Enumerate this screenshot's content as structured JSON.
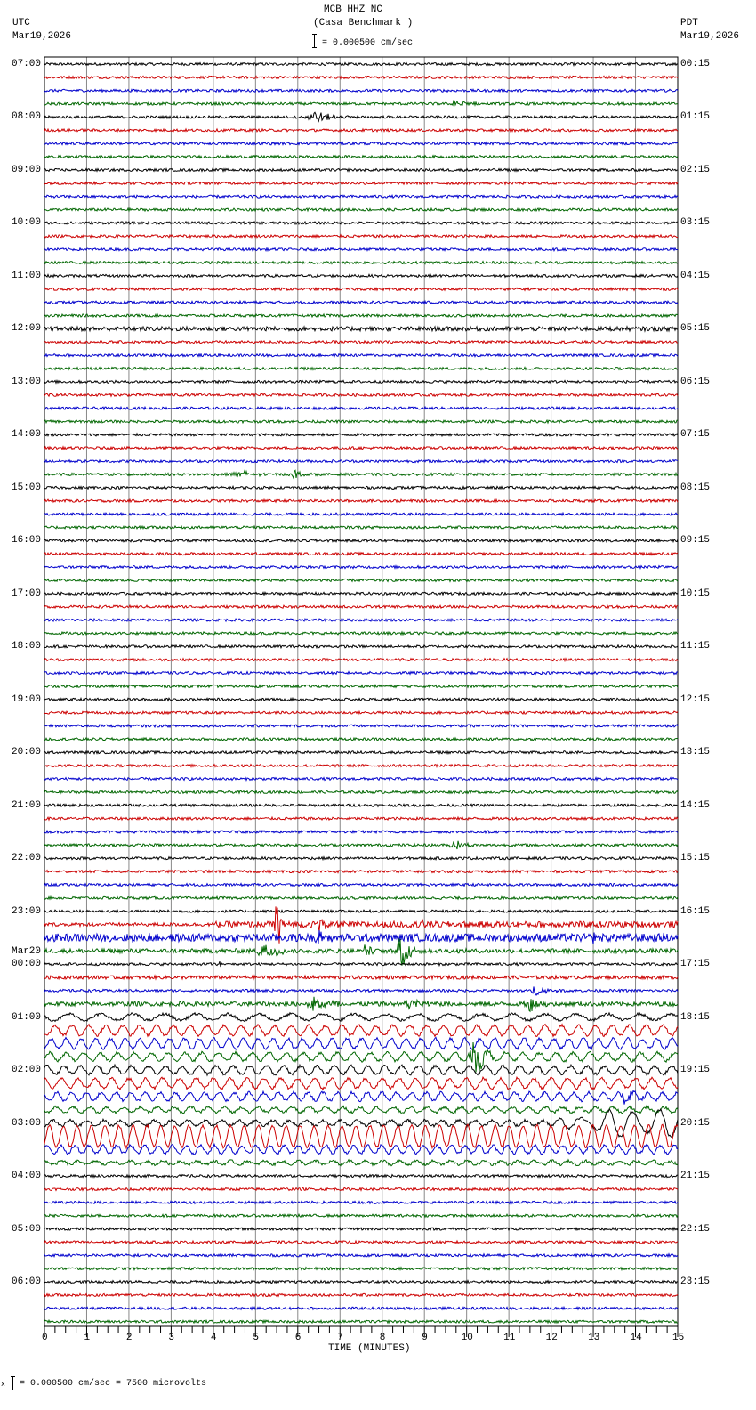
{
  "header": {
    "station": "MCB HHZ NC",
    "site": "(Casa Benchmark )",
    "scale": "= 0.000500 cm/sec",
    "left_tz": "UTC",
    "left_date": "Mar19,2026",
    "right_tz": "PDT",
    "right_date": "Mar19,2026"
  },
  "footer": {
    "scale_prefix": "x",
    "scale": "= 0.000500 cm/sec =    7500 microvolts"
  },
  "chart_data": {
    "type": "line",
    "title": "MCB HHZ NC (Casa Benchmark )",
    "xlabel": "TIME (MINUTES)",
    "xlim": [
      0,
      15
    ],
    "x_ticks": [
      "0",
      "1",
      "2",
      "3",
      "4",
      "5",
      "6",
      "7",
      "8",
      "9",
      "10",
      "11",
      "12",
      "13",
      "14",
      "15"
    ],
    "left_labels": [
      "07:00",
      "08:00",
      "09:00",
      "10:00",
      "11:00",
      "12:00",
      "13:00",
      "14:00",
      "15:00",
      "16:00",
      "17:00",
      "18:00",
      "19:00",
      "20:00",
      "21:00",
      "22:00",
      "23:00",
      "00:00",
      "01:00",
      "02:00",
      "03:00",
      "04:00",
      "05:00",
      "06:00"
    ],
    "date_change_label": "Mar20",
    "right_labels": [
      "00:15",
      "01:15",
      "02:15",
      "03:15",
      "04:15",
      "05:15",
      "06:15",
      "07:15",
      "08:15",
      "09:15",
      "10:15",
      "11:15",
      "12:15",
      "13:15",
      "14:15",
      "15:15",
      "16:15",
      "17:15",
      "18:15",
      "19:15",
      "20:15",
      "21:15",
      "22:15",
      "23:15"
    ],
    "trace_colors": [
      "#000000",
      "#cc0000",
      "#0000cc",
      "#006600"
    ],
    "traces_per_hour": 4,
    "trace_count": 96,
    "default_noise": 0.15,
    "special_traces": [
      {
        "i": 3,
        "events": [
          {
            "t": 9.7,
            "d": 0.6,
            "a": 0.6
          }
        ]
      },
      {
        "i": 4,
        "events": [
          {
            "t": 6.4,
            "d": 0.8,
            "a": 0.7
          }
        ]
      },
      {
        "i": 20,
        "noise": 0.25
      },
      {
        "i": 31,
        "events": [
          {
            "t": 4.6,
            "d": 0.8,
            "a": 0.5
          },
          {
            "t": 5.9,
            "d": 0.4,
            "a": 0.6
          }
        ]
      },
      {
        "i": 59,
        "events": [
          {
            "t": 9.7,
            "d": 0.5,
            "a": 0.6
          }
        ]
      },
      {
        "i": 65,
        "noise": 0.2,
        "noise2": 0.35,
        "noise2_from": 4,
        "events": [
          {
            "t": 5.5,
            "d": 0.25,
            "a": 3.5
          },
          {
            "t": 6.5,
            "d": 0.3,
            "a": 1.2
          },
          {
            "t": 8.9,
            "d": 0.2,
            "a": 0.8
          }
        ]
      },
      {
        "i": 66,
        "noise": 0.45,
        "events": [
          {
            "t": 6.5,
            "d": 0.3,
            "a": 1
          },
          {
            "t": 13,
            "d": 0.1,
            "a": 1.2
          }
        ]
      },
      {
        "i": 67,
        "noise": 0.25,
        "events": [
          {
            "t": 5.2,
            "d": 0.6,
            "a": 1.2
          },
          {
            "t": 7.6,
            "d": 0.2,
            "a": 1
          },
          {
            "t": 8.45,
            "d": 0.4,
            "a": 3
          }
        ]
      },
      {
        "i": 68,
        "events": [
          {
            "t": 4.1,
            "d": 0.3,
            "a": 0.7
          }
        ]
      },
      {
        "i": 69,
        "noise": 0.2
      },
      {
        "i": 70,
        "events": [
          {
            "t": 11.6,
            "d": 0.6,
            "a": 0.6
          }
        ]
      },
      {
        "i": 71,
        "noise": 0.25,
        "events": [
          {
            "t": 6.4,
            "d": 1,
            "a": 0.8
          },
          {
            "t": 8.6,
            "d": 0.6,
            "a": 0.9
          },
          {
            "t": 11.5,
            "d": 0.5,
            "a": 1
          }
        ]
      },
      {
        "i": 72,
        "wave": {
          "a": 0.35,
          "p": 0.75
        }
      },
      {
        "i": 73,
        "wave": {
          "a": 0.55,
          "p": 0.4
        }
      },
      {
        "i": 74,
        "wave": {
          "a": 0.55,
          "p": 0.35
        }
      },
      {
        "i": 75,
        "wave": {
          "a": 0.45,
          "p": 0.4
        },
        "events": [
          {
            "t": 10.2,
            "d": 0.6,
            "a": 1.8
          }
        ]
      },
      {
        "i": 76,
        "wave": {
          "a": 0.45,
          "p": 0.4
        }
      },
      {
        "i": 77,
        "wave": {
          "a": 0.55,
          "p": 0.4
        }
      },
      {
        "i": 78,
        "wave": {
          "a": 0.45,
          "p": 0.35
        },
        "events": [
          {
            "t": 13.8,
            "d": 0.8,
            "a": 0.6
          }
        ]
      },
      {
        "i": 79,
        "wave": {
          "a": 0.3,
          "p": 0.4
        }
      },
      {
        "i": 80,
        "wave": {
          "a": 0.3,
          "p": 0.4
        },
        "wave2": {
          "a": 1.3,
          "p": 0.6,
          "from": 12
        }
      },
      {
        "i": 81,
        "wave": {
          "a": 1.2,
          "p": 0.33
        }
      },
      {
        "i": 82,
        "wave": {
          "a": 0.45,
          "p": 0.33
        }
      },
      {
        "i": 83,
        "wave": {
          "a": 0.2,
          "p": 0.4
        }
      }
    ]
  }
}
